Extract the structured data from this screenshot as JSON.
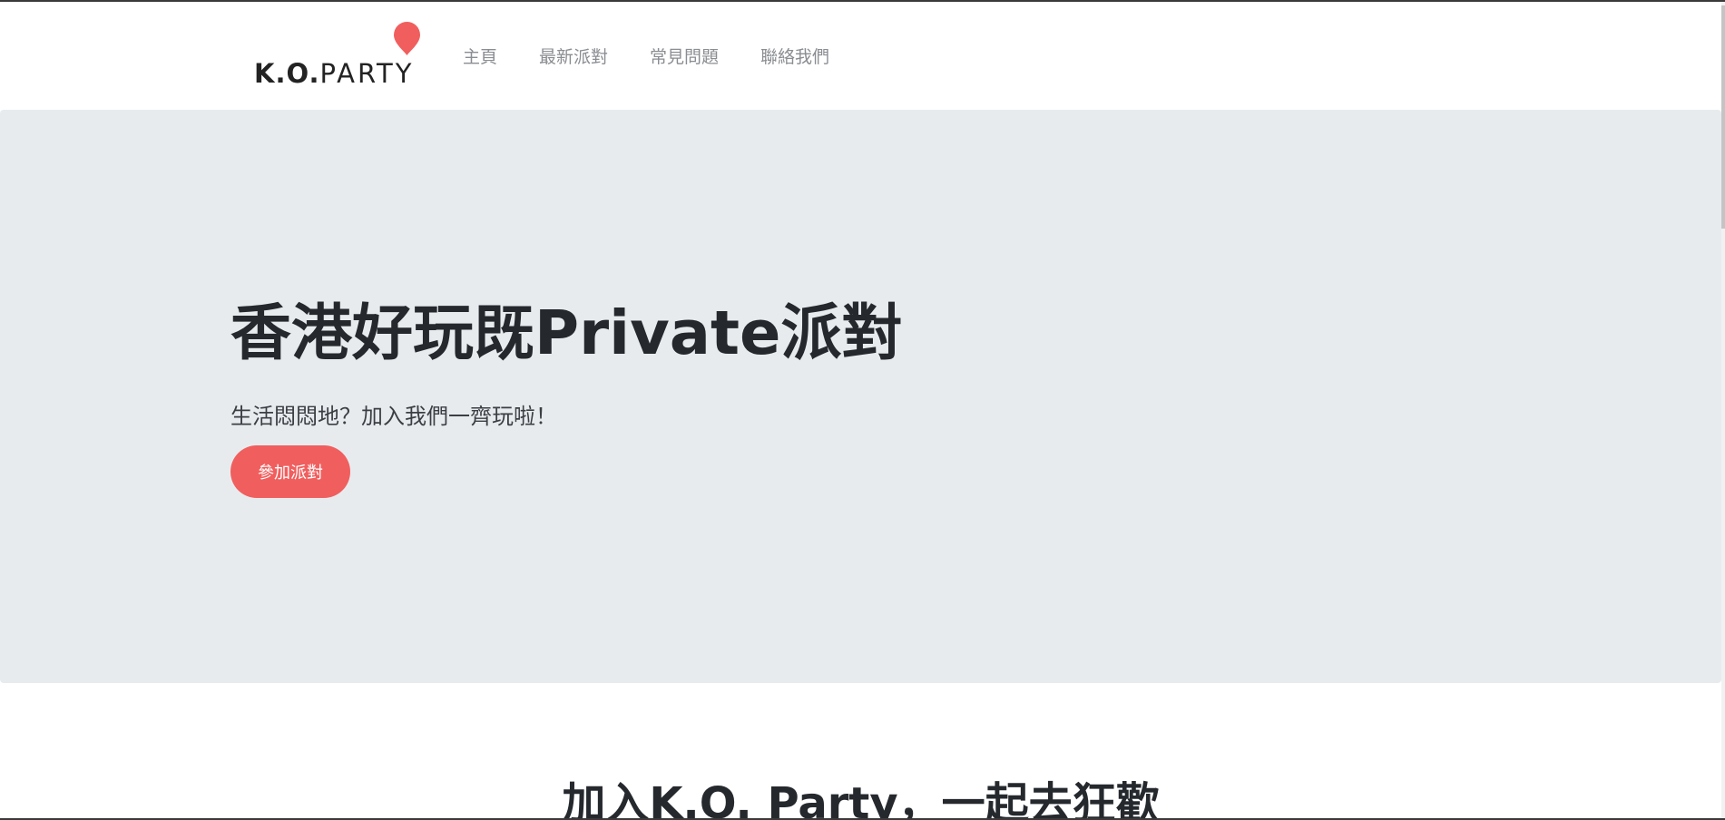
{
  "brand": {
    "logo_ko": "K.O.",
    "logo_party": "PARTY",
    "pin_color": "#f15e5e"
  },
  "nav": {
    "items": [
      {
        "label": "主頁"
      },
      {
        "label": "最新派對"
      },
      {
        "label": "常見問題"
      },
      {
        "label": "聯絡我們"
      }
    ]
  },
  "hero": {
    "title": "香港好玩既Private派對",
    "subtitle": "生活悶悶地？加入我們一齊玩啦！",
    "button_label": "參加派對",
    "background_color": "#e8ebee",
    "accent_color": "#f15e5e"
  },
  "section": {
    "heading": "加入K.O. Party，一起去狂歡"
  }
}
